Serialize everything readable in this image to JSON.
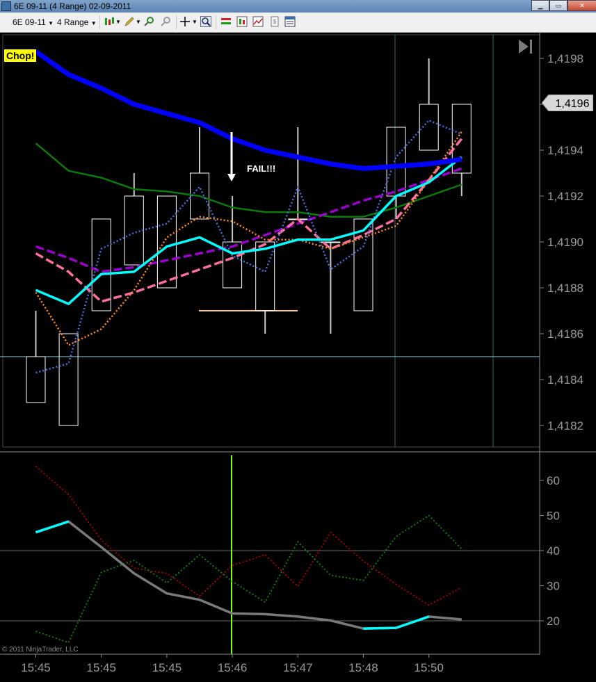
{
  "window": {
    "title": "6E 09-11 (4 Range)  02-09-2011"
  },
  "toolbar": {
    "instrument": "6E 09-11",
    "interval": "4 Range",
    "icons": [
      "candlestick-icon",
      "pencil-icon",
      "zoom-in-icon",
      "zoom-out-icon",
      "crosshair-icon",
      "magnifier-icon",
      "order-icon",
      "indicator-icon",
      "strategy-icon",
      "data-icon",
      "properties-icon"
    ]
  },
  "annotations": {
    "chop": "Chop!",
    "fail": "FAIL!!!"
  },
  "price_axis": {
    "current_price": "1,4196",
    "ticks": [
      "1,4198",
      "1,4196",
      "1,4194",
      "1,4192",
      "1,4190",
      "1,4188",
      "1,4186",
      "1,4184",
      "1,4182"
    ]
  },
  "osc_axis": {
    "ticks": [
      "60",
      "50",
      "40",
      "30",
      "20"
    ]
  },
  "time_axis": {
    "ticks": [
      "15:45",
      "15:45",
      "15:45",
      "15:46",
      "15:47",
      "15:48",
      "15:50"
    ]
  },
  "copyright": "© 2011 NinjaTrader, LLC",
  "colors": {
    "background": "#000000",
    "candle": "#ffffff",
    "slow_ma": "#0000ff",
    "green_ma": "#0a7a0a",
    "cyan_ma": "#00ffff",
    "purple_ma": "#9900cc",
    "pink_ma": "#ff6fa0",
    "orange_ma": "#ff8c1a",
    "blue_dotted": "#4f6fd6",
    "osc_gray": "#7a7a7a",
    "osc_cyan": "#00ffff",
    "osc_red": "#b00000",
    "osc_green": "#0a8a0a",
    "cursor": "#7fff00"
  },
  "chart_data": [
    {
      "type": "candlestick",
      "title": "6E 09-11 (4 Range)",
      "ylim": [
        1.41805,
        1.4199
      ],
      "candles": [
        {
          "open": 1.4183,
          "high": 1.4187,
          "low": 1.4183,
          "close": 1.4185
        },
        {
          "open": 1.4182,
          "high": 1.4186,
          "low": 1.4182,
          "close": 1.4186
        },
        {
          "open": 1.4187,
          "high": 1.4191,
          "low": 1.4187,
          "close": 1.4191
        },
        {
          "open": 1.4189,
          "high": 1.4193,
          "low": 1.4189,
          "close": 1.4192
        },
        {
          "open": 1.4188,
          "high": 1.4192,
          "low": 1.4188,
          "close": 1.4192
        },
        {
          "open": 1.4191,
          "high": 1.4195,
          "low": 1.4191,
          "close": 1.4193
        },
        {
          "open": 1.4188,
          "high": 1.4192,
          "low": 1.4188,
          "close": 1.419
        },
        {
          "open": 1.4187,
          "high": 1.419,
          "low": 1.4186,
          "close": 1.419
        },
        {
          "open": 1.4191,
          "high": 1.4195,
          "low": 1.4191,
          "close": 1.4191
        },
        {
          "open": 1.419,
          "high": 1.419,
          "low": 1.4186,
          "close": 1.419
        },
        {
          "open": 1.4187,
          "high": 1.4191,
          "low": 1.4187,
          "close": 1.4191
        },
        {
          "open": 1.4192,
          "high": 1.4195,
          "low": 1.4191,
          "close": 1.4195
        },
        {
          "open": 1.4194,
          "high": 1.4198,
          "low": 1.4194,
          "close": 1.4196
        },
        {
          "open": 1.4193,
          "high": 1.4196,
          "low": 1.4192,
          "close": 1.4196
        }
      ],
      "series": [
        {
          "style": "blue-thick",
          "values": [
            1.41983,
            1.41973,
            1.41967,
            1.4196,
            1.41956,
            1.41952,
            1.41945,
            1.4194,
            1.41937,
            1.41934,
            1.41932,
            1.41933,
            1.41934,
            1.41936
          ]
        },
        {
          "style": "green",
          "values": [
            1.41943,
            1.41931,
            1.41928,
            1.41923,
            1.41922,
            1.4192,
            1.41915,
            1.41913,
            1.41913,
            1.41911,
            1.41911,
            1.41915,
            1.4192,
            1.41925
          ]
        },
        {
          "style": "cyan",
          "values": [
            1.41879,
            1.41873,
            1.41886,
            1.41887,
            1.41898,
            1.41902,
            1.41895,
            1.41897,
            1.41901,
            1.41901,
            1.41905,
            1.4192,
            1.41926,
            1.41937
          ]
        },
        {
          "style": "purple-dashed",
          "values": [
            1.41898,
            1.41893,
            1.41887,
            1.41889,
            1.41892,
            1.41895,
            1.41898,
            1.41903,
            1.41908,
            1.41913,
            1.41918,
            1.41922,
            1.41927,
            1.41932
          ]
        },
        {
          "style": "pink-dashed",
          "values": [
            1.41895,
            1.41887,
            1.41874,
            1.41878,
            1.41883,
            1.41888,
            1.41893,
            1.41899,
            1.4191,
            1.41897,
            1.41903,
            1.4191,
            1.41927,
            1.41945
          ]
        },
        {
          "style": "orange-dotted",
          "values": [
            1.41878,
            1.41855,
            1.41862,
            1.41879,
            1.41902,
            1.41911,
            1.41909,
            1.41901,
            1.41901,
            1.41897,
            1.41902,
            1.41907,
            1.41927,
            1.41948
          ]
        },
        {
          "style": "blue-dotted",
          "values": [
            1.41843,
            1.41847,
            1.41897,
            1.41904,
            1.41908,
            1.41924,
            1.41894,
            1.41887,
            1.41924,
            1.41888,
            1.41898,
            1.41937,
            1.41953,
            1.41947
          ]
        }
      ],
      "levels": [
        {
          "y": 1.4185,
          "color": "#8fd3d8"
        },
        {
          "y": 1.4187,
          "color": "#ffc8a8"
        }
      ]
    },
    {
      "type": "line",
      "ylim": [
        10,
        68
      ],
      "x": [
        "15:45",
        "15:45",
        "15:45",
        "15:45",
        "15:45",
        "15:45",
        "15:46",
        "15:46",
        "15:47",
        "15:47",
        "15:48",
        "15:48",
        "15:50",
        "15:50"
      ],
      "series": [
        {
          "style": "main",
          "values": [
            45.2,
            48.3,
            41.0,
            33.5,
            27.8,
            26.0,
            22.1,
            21.9,
            21.2,
            20.1,
            17.8,
            18.0,
            21.2,
            20.4
          ]
        },
        {
          "style": "red-dotted",
          "values": [
            64.0,
            56.0,
            43.0,
            35.0,
            33.5,
            27.0,
            35.8,
            38.8,
            29.8,
            45.2,
            37.0,
            30.4,
            24.5,
            29.5
          ]
        },
        {
          "style": "green-dotted",
          "values": [
            17.0,
            13.8,
            33.8,
            37.2,
            30.8,
            38.8,
            31.2,
            25.3,
            42.5,
            33.0,
            31.5,
            44.0,
            50.0,
            40.5
          ]
        }
      ],
      "cyan_segments": [
        [
          0,
          1
        ],
        [
          10,
          12
        ]
      ],
      "grid": [
        40,
        20
      ]
    }
  ]
}
